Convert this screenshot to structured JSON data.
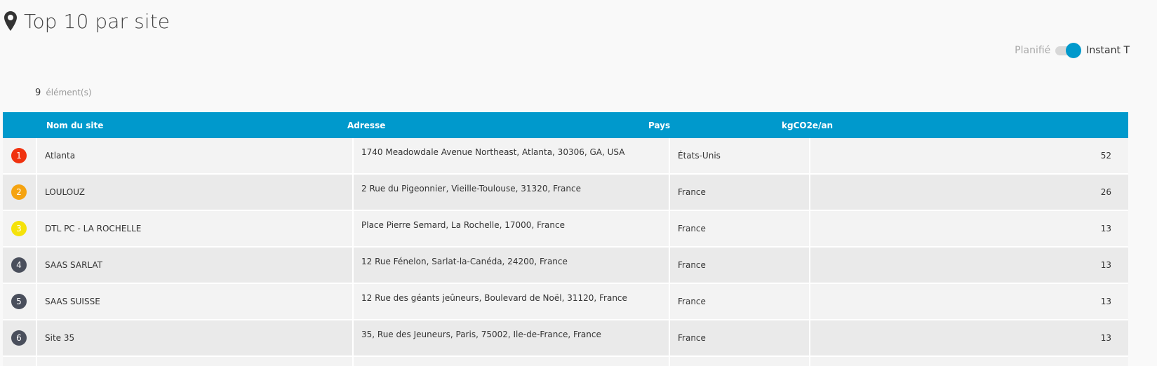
{
  "header": {
    "title": "Top 10 par site",
    "icon": "map-pin-icon"
  },
  "toggle": {
    "left_label": "Planifié",
    "right_label": "Instant T",
    "state": "Instant T",
    "active_color": "#0099cc"
  },
  "count": {
    "value": "9",
    "label": "élément(s)"
  },
  "table": {
    "header_color": "#0099cc",
    "columns": [
      "Nom du site",
      "Adresse",
      "Pays",
      "kgCO2e/an"
    ],
    "rows": [
      {
        "rank": "1",
        "badge_color": "#f0320f",
        "name": "Atlanta",
        "address": "1740 Meadowdale Avenue Northeast, Atlanta, 30306, GA, USA",
        "country": "États-Unis",
        "value": "52"
      },
      {
        "rank": "2",
        "badge_color": "#f5a310",
        "name": "LOULOUZ",
        "address": "2 Rue du Pigeonnier, Vieille-Toulouse, 31320, France",
        "country": "France",
        "value": "26"
      },
      {
        "rank": "3",
        "badge_color": "#f5e20a",
        "name": "DTL PC - LA ROCHELLE",
        "address": "Place Pierre Semard, La Rochelle, 17000, France",
        "country": "France",
        "value": "13"
      },
      {
        "rank": "4",
        "badge_color": "#4a4f5c",
        "name": "SAAS SARLAT",
        "address": "12 Rue Fénelon, Sarlat-la-Canéda, 24200, France",
        "country": "France",
        "value": "13"
      },
      {
        "rank": "5",
        "badge_color": "#4a4f5c",
        "name": "SAAS SUISSE",
        "address": "12 Rue des géants jeûneurs, Boulevard de Noël, 31120, France",
        "country": "France",
        "value": "13"
      },
      {
        "rank": "6",
        "badge_color": "#4a4f5c",
        "name": "Site 35",
        "address": "35, Rue des Jeuneurs, Paris, 75002, Ile-de-France, France",
        "country": "France",
        "value": "13"
      }
    ]
  }
}
